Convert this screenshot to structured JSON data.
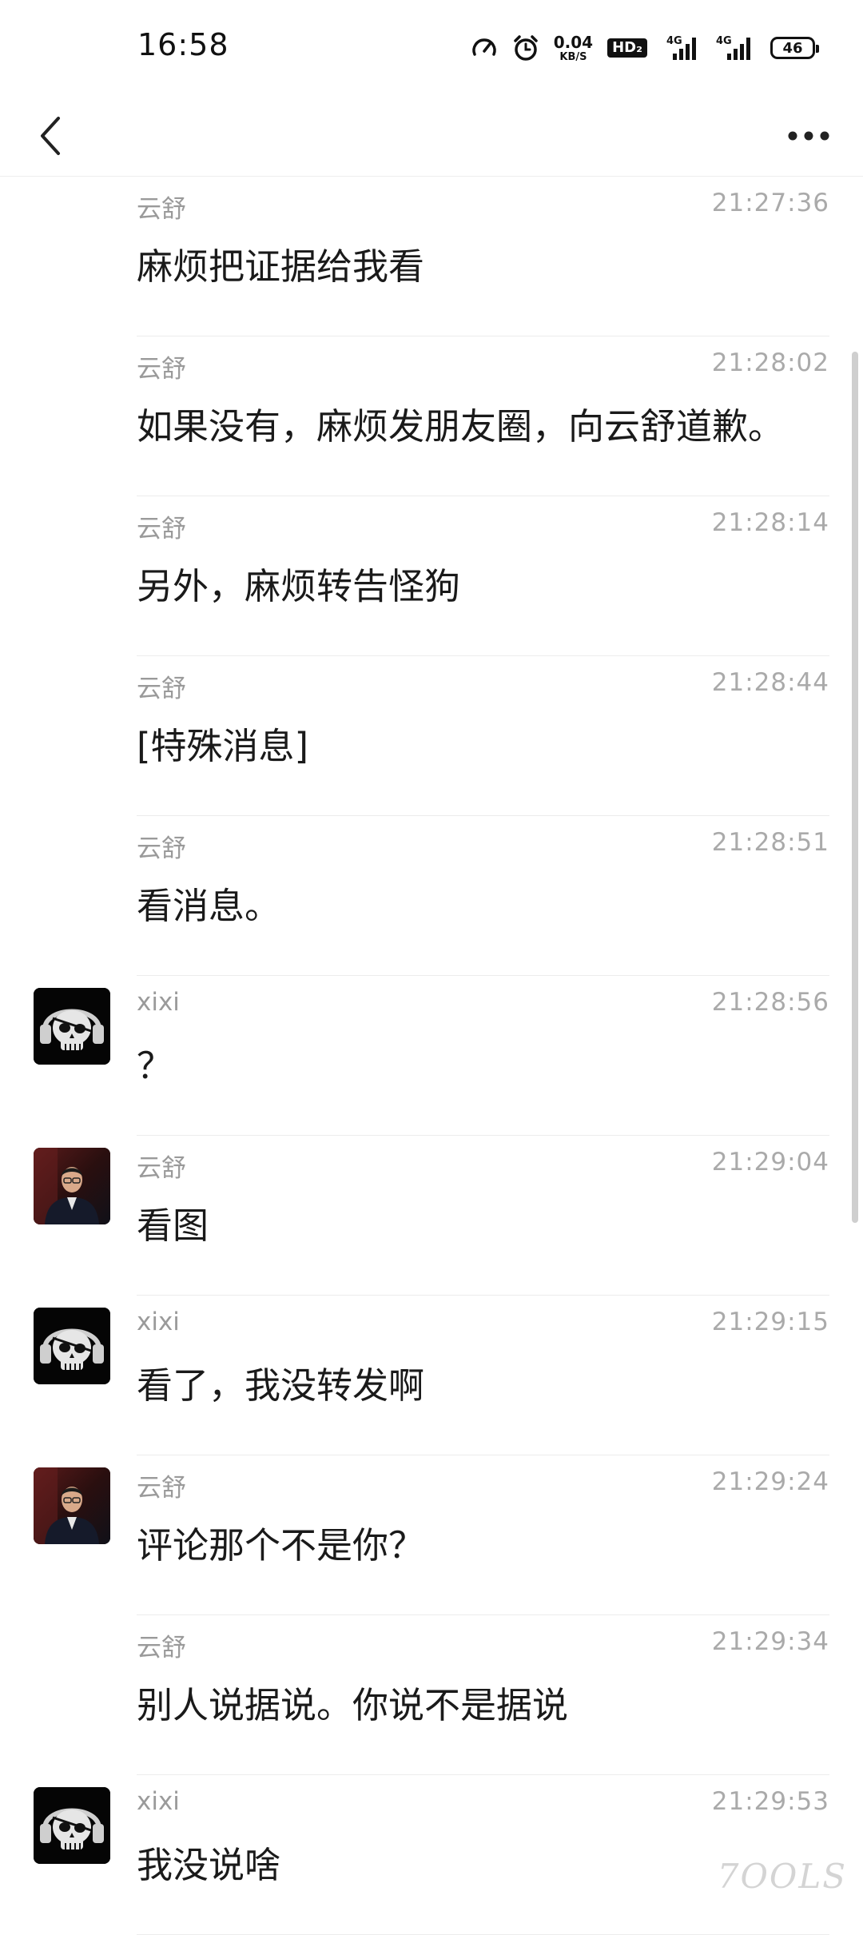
{
  "status_bar": {
    "time": "16:58",
    "net_speed_value": "0.04",
    "net_speed_unit": "KB/S",
    "hd_label": "HD₂",
    "signal1_label": "4G",
    "signal2_label": "4G",
    "battery": "46"
  },
  "nav": {
    "back_icon": "chevron-left-icon",
    "more_icon": "more-horizontal-icon"
  },
  "messages": [
    {
      "sender": "云舒",
      "time": "21:27:36",
      "text": "麻烦把证据给我看",
      "avatar": ""
    },
    {
      "sender": "云舒",
      "time": "21:28:02",
      "text": "如果没有，麻烦发朋友圈，向云舒道歉。",
      "avatar": ""
    },
    {
      "sender": "云舒",
      "time": "21:28:14",
      "text": "另外，麻烦转告怪狗",
      "avatar": ""
    },
    {
      "sender": "云舒",
      "time": "21:28:44",
      "text": "[特殊消息]",
      "avatar": ""
    },
    {
      "sender": "云舒",
      "time": "21:28:51",
      "text": "看消息。",
      "avatar": ""
    },
    {
      "sender": "xixi",
      "time": "21:28:56",
      "text": "？",
      "avatar": "skull"
    },
    {
      "sender": "云舒",
      "time": "21:29:04",
      "text": "看图",
      "avatar": "person"
    },
    {
      "sender": "xixi",
      "time": "21:29:15",
      "text": "看了，我没转发啊",
      "avatar": "skull"
    },
    {
      "sender": "云舒",
      "time": "21:29:24",
      "text": "评论那个不是你？",
      "avatar": "person"
    },
    {
      "sender": "云舒",
      "time": "21:29:34",
      "text": "别人说据说。你说不是据说",
      "avatar": ""
    },
    {
      "sender": "xixi",
      "time": "21:29:53",
      "text": "我没说啥",
      "avatar": "skull"
    }
  ],
  "watermark": "7OOLS"
}
